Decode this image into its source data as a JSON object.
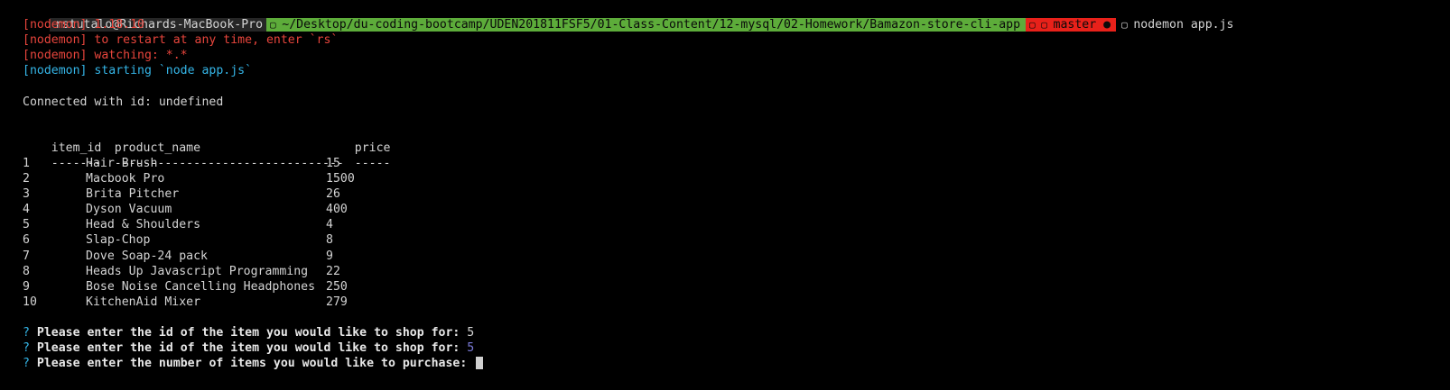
{
  "prompt": {
    "user_host": "rstutalo@Richards-MacBook-Pro",
    "path": "~/Desktop/du-coding-bootcamp/UDEN201811FSF5/01-Class-Content/12-mysql/02-Homework/Bamazon-store-cli-app",
    "branch": "master ●",
    "command": "nodemon app.js"
  },
  "nodemon": {
    "version": "[nodemon] 1.18.10",
    "restart": "[nodemon] to restart at any time, enter `rs`",
    "watching": "[nodemon] watching: *.*",
    "starting": "[nodemon] starting `node app.js`"
  },
  "connected": "Connected with id: undefined",
  "table": {
    "headers": [
      "item_id",
      "product_name",
      "price"
    ],
    "underlines": [
      "-------",
      "--------------------------------",
      "-----"
    ],
    "rows": [
      [
        "1",
        "Hair Brush",
        "15"
      ],
      [
        "2",
        "Macbook Pro",
        "1500"
      ],
      [
        "3",
        "Brita Pitcher",
        "26"
      ],
      [
        "4",
        "Dyson Vacuum",
        "400"
      ],
      [
        "5",
        "Head & Shoulders",
        "4"
      ],
      [
        "6",
        "Slap-Chop",
        "8"
      ],
      [
        "7",
        "Dove Soap-24 pack",
        "9"
      ],
      [
        "8",
        "Heads Up Javascript Programming",
        "22"
      ],
      [
        "9",
        "Bose Noise Cancelling Headphones",
        "250"
      ],
      [
        "10",
        "KitchenAid Mixer",
        "279"
      ]
    ]
  },
  "questions": [
    {
      "mark": "?",
      "text": "Please enter the id of the item you would like to shop for: ",
      "answer": "5"
    },
    {
      "mark": "?",
      "text": "Please enter the id of the item you would like to shop for: ",
      "answer": "5"
    },
    {
      "mark": "?",
      "text": "Please enter the number of items you would like to purchase: ",
      "answer": ""
    }
  ],
  "colors": {
    "background": "#000000",
    "path_segment": "#5dac3a",
    "git_segment": "#e8211a",
    "nodemon_red": "#e8453c",
    "nodemon_cyan": "#35b6e8"
  }
}
